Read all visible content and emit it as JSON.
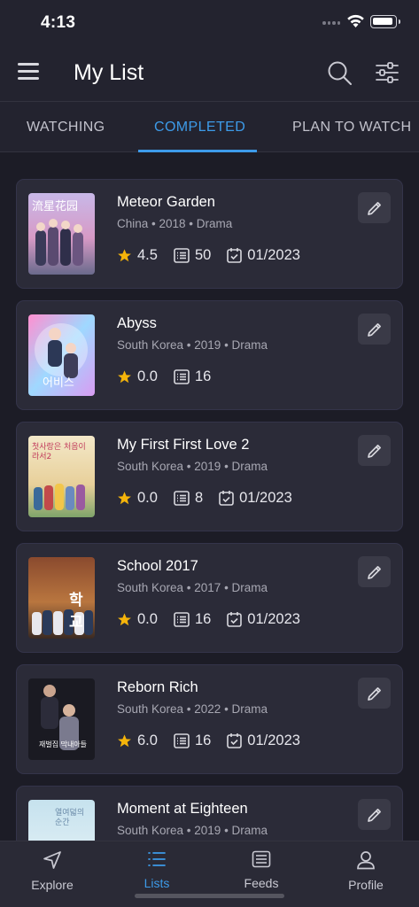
{
  "status_bar": {
    "time": "4:13"
  },
  "header": {
    "title": "My List"
  },
  "tabs": [
    {
      "label": "WATCHING",
      "active": false
    },
    {
      "label": "COMPLETED",
      "active": true
    },
    {
      "label": "PLAN TO WATCH",
      "active": false
    }
  ],
  "colors": {
    "accent": "#3d9be9",
    "star": "#f5b40a",
    "background": "#1c1c26",
    "card": "#2b2b38"
  },
  "list": [
    {
      "title": "Meteor Garden",
      "meta": "China • 2018 • Drama",
      "rating": "4.5",
      "episodes": "50",
      "date": "01/2023",
      "poster_text": "流星花园"
    },
    {
      "title": "Abyss",
      "meta": "South Korea • 2019 • Drama",
      "rating": "0.0",
      "episodes": "16",
      "date": "",
      "poster_text": "어비스"
    },
    {
      "title": "My First First Love 2",
      "meta": "South Korea • 2019 • Drama",
      "rating": "0.0",
      "episodes": "8",
      "date": "01/2023",
      "poster_text": "첫사랑은 처음이라서2"
    },
    {
      "title": "School 2017",
      "meta": "South Korea • 2017 • Drama",
      "rating": "0.0",
      "episodes": "16",
      "date": "01/2023",
      "poster_text": "학교"
    },
    {
      "title": "Reborn Rich",
      "meta": "South Korea • 2022 • Drama",
      "rating": "6.0",
      "episodes": "16",
      "date": "01/2023",
      "poster_text": "재벌집 막내아들"
    },
    {
      "title": "Moment at Eighteen",
      "meta": "South Korea • 2019 • Drama",
      "rating": "",
      "episodes": "",
      "date": "",
      "poster_text": "열여덟의 순간"
    }
  ],
  "bottom_nav": [
    {
      "label": "Explore",
      "icon": "navigation-arrow-icon",
      "active": false
    },
    {
      "label": "Lists",
      "icon": "list-icon",
      "active": true
    },
    {
      "label": "Feeds",
      "icon": "feed-icon",
      "active": false
    },
    {
      "label": "Profile",
      "icon": "person-icon",
      "active": false
    }
  ]
}
